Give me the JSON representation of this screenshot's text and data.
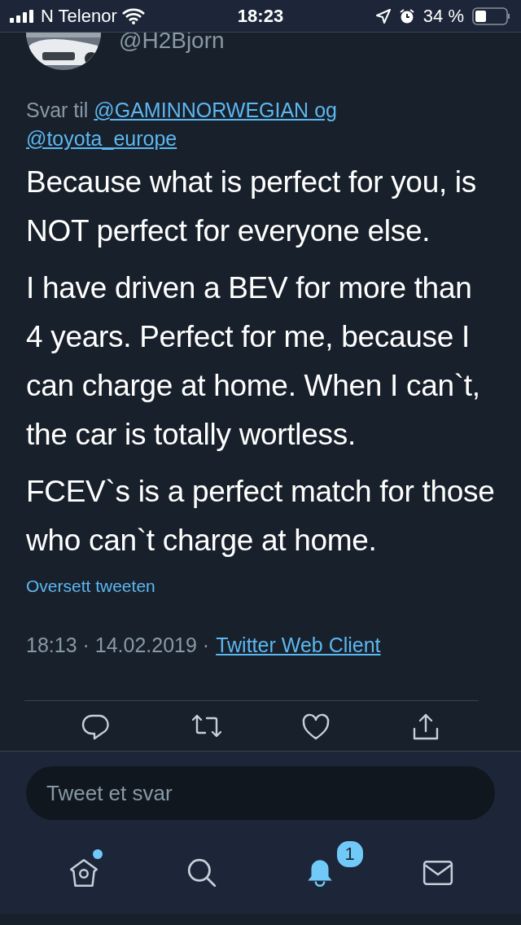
{
  "status_bar": {
    "carrier": "N Telenor",
    "time": "18:23",
    "battery": "34 %"
  },
  "author": {
    "handle": "@H2Bjorn"
  },
  "reply_to": {
    "prefix": "Svar til",
    "mentions": [
      "@GAMINNORWEGIAN",
      "@toyota_europe"
    ],
    "joiner": "og"
  },
  "tweet": {
    "paragraphs": [
      "Because what is perfect for you, is NOT perfect for everyone else.",
      "I have driven a BEV for more than 4 years. Perfect for me, because I can charge at home. When I can`t, the car is totally wortless.",
      "FCEV`s is a perfect match for those who can`t charge at home."
    ],
    "translate": "Oversett tweeten",
    "timestamp": "18:13 · 14.02.2019 ·",
    "client": "Twitter Web Client"
  },
  "actions": [
    {
      "kind": "reply"
    },
    {
      "kind": "retweet"
    },
    {
      "kind": "like"
    },
    {
      "kind": "share"
    }
  ],
  "composer": {
    "placeholder": "Tweet et svar"
  },
  "nav": [
    {
      "kind": "home",
      "selected": false,
      "unread": true
    },
    {
      "kind": "search",
      "selected": false,
      "unread": false
    },
    {
      "kind": "notifications",
      "selected": true,
      "unread": false,
      "badge": "1"
    },
    {
      "kind": "messages",
      "selected": false,
      "unread": false
    }
  ]
}
